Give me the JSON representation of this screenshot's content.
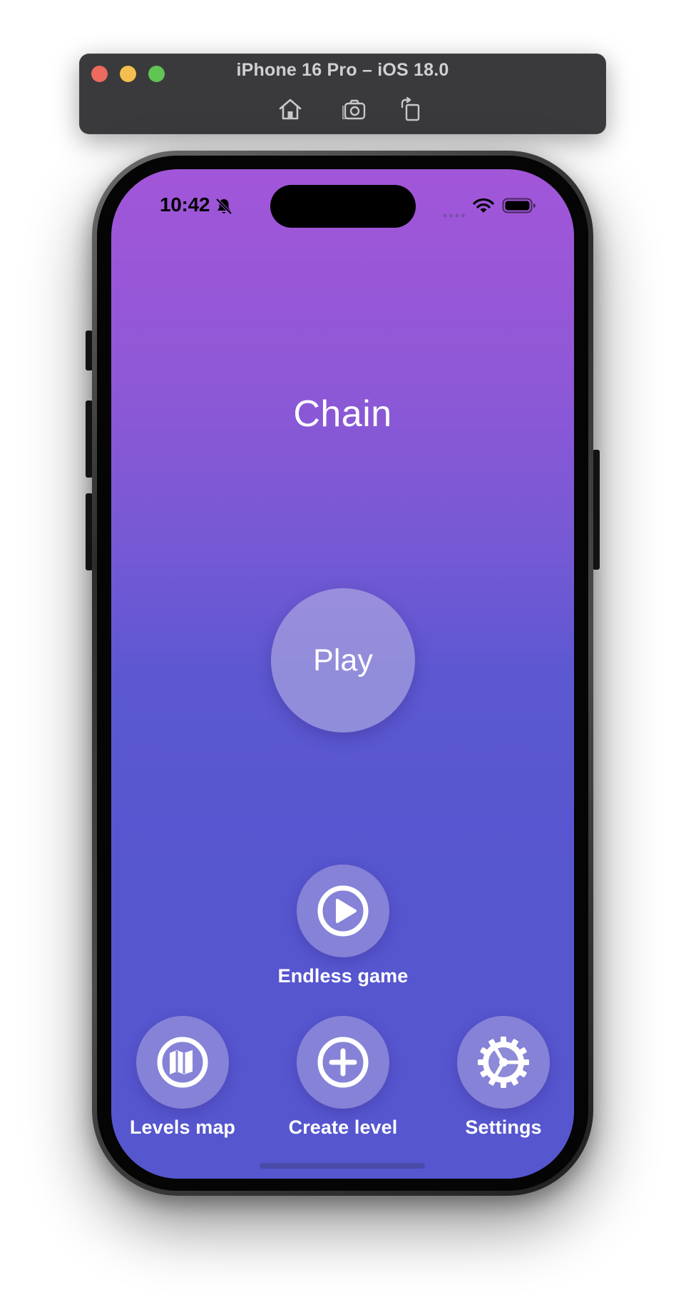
{
  "simulator": {
    "title": "iPhone 16 Pro – iOS 18.0",
    "buttons": [
      "home-icon",
      "screenshot-icon",
      "rotate-icon"
    ]
  },
  "status_bar": {
    "time": "10:42",
    "icons": [
      "bell-slash-icon",
      "cellular-dots-icon",
      "wifi-icon",
      "battery-icon"
    ]
  },
  "app": {
    "title": "Chain",
    "play_label": "Play",
    "endless": {
      "label": "Endless game",
      "icon": "play-circle-icon"
    },
    "bottom_actions": [
      {
        "label": "Levels map",
        "icon": "map-icon"
      },
      {
        "label": "Create level",
        "icon": "plus-circle-icon"
      },
      {
        "label": "Settings",
        "icon": "gear-icon"
      }
    ]
  },
  "colors": {
    "gradient_top": "#a256d8",
    "gradient_bottom": "#5656cf",
    "button_fill": "#bebae1",
    "text": "#ffffff"
  }
}
